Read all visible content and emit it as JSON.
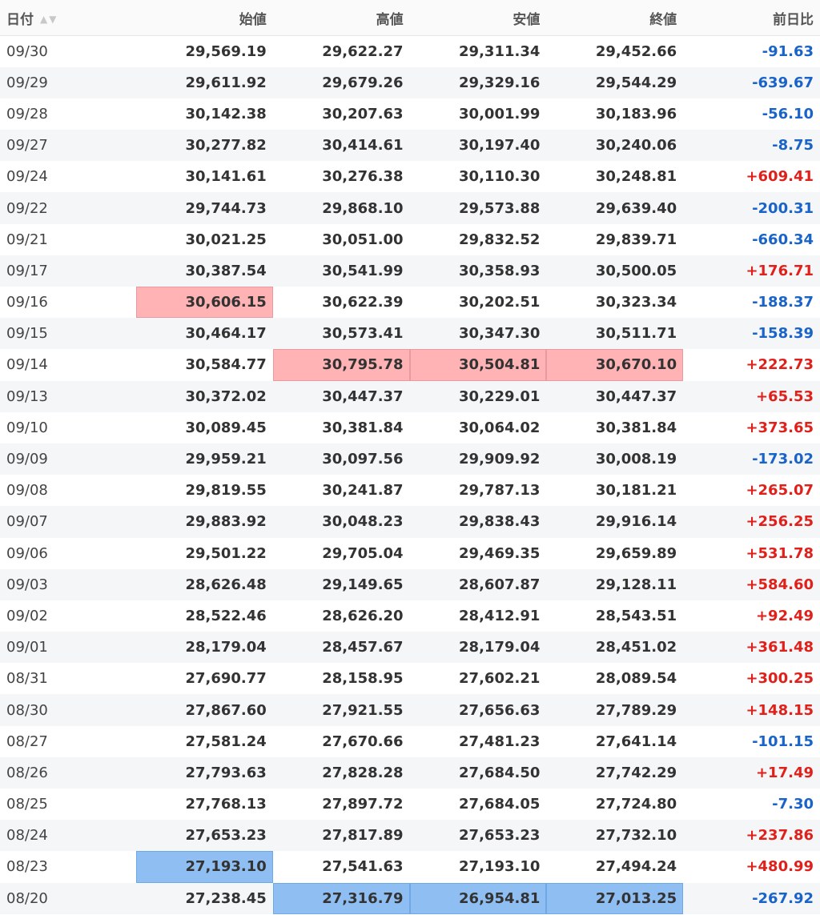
{
  "headers": {
    "date": "日付",
    "open": "始値",
    "high": "高値",
    "low": "安値",
    "close": "終値",
    "change": "前日比"
  },
  "colors": {
    "positive": "#e0201a",
    "negative": "#1a63c8",
    "high_highlight": "#ffb3b5",
    "low_highlight": "#8fbff2"
  },
  "rows": [
    {
      "date": "09/30",
      "open": "29,569.19",
      "high": "29,622.27",
      "low": "29,311.34",
      "close": "29,452.66",
      "change": "-91.63"
    },
    {
      "date": "09/29",
      "open": "29,611.92",
      "high": "29,679.26",
      "low": "29,329.16",
      "close": "29,544.29",
      "change": "-639.67"
    },
    {
      "date": "09/28",
      "open": "30,142.38",
      "high": "30,207.63",
      "low": "30,001.99",
      "close": "30,183.96",
      "change": "-56.10"
    },
    {
      "date": "09/27",
      "open": "30,277.82",
      "high": "30,414.61",
      "low": "30,197.40",
      "close": "30,240.06",
      "change": "-8.75"
    },
    {
      "date": "09/24",
      "open": "30,141.61",
      "high": "30,276.38",
      "low": "30,110.30",
      "close": "30,248.81",
      "change": "+609.41"
    },
    {
      "date": "09/22",
      "open": "29,744.73",
      "high": "29,868.10",
      "low": "29,573.88",
      "close": "29,639.40",
      "change": "-200.31"
    },
    {
      "date": "09/21",
      "open": "30,021.25",
      "high": "30,051.00",
      "low": "29,832.52",
      "close": "29,839.71",
      "change": "-660.34"
    },
    {
      "date": "09/17",
      "open": "30,387.54",
      "high": "30,541.99",
      "low": "30,358.93",
      "close": "30,500.05",
      "change": "+176.71"
    },
    {
      "date": "09/16",
      "open": "30,606.15",
      "high": "30,622.39",
      "low": "30,202.51",
      "close": "30,323.34",
      "change": "-188.37",
      "hl": {
        "open": "red"
      }
    },
    {
      "date": "09/15",
      "open": "30,464.17",
      "high": "30,573.41",
      "low": "30,347.30",
      "close": "30,511.71",
      "change": "-158.39"
    },
    {
      "date": "09/14",
      "open": "30,584.77",
      "high": "30,795.78",
      "low": "30,504.81",
      "close": "30,670.10",
      "change": "+222.73",
      "hl": {
        "high": "red",
        "low": "red",
        "close": "red"
      }
    },
    {
      "date": "09/13",
      "open": "30,372.02",
      "high": "30,447.37",
      "low": "30,229.01",
      "close": "30,447.37",
      "change": "+65.53"
    },
    {
      "date": "09/10",
      "open": "30,089.45",
      "high": "30,381.84",
      "low": "30,064.02",
      "close": "30,381.84",
      "change": "+373.65"
    },
    {
      "date": "09/09",
      "open": "29,959.21",
      "high": "30,097.56",
      "low": "29,909.92",
      "close": "30,008.19",
      "change": "-173.02"
    },
    {
      "date": "09/08",
      "open": "29,819.55",
      "high": "30,241.87",
      "low": "29,787.13",
      "close": "30,181.21",
      "change": "+265.07"
    },
    {
      "date": "09/07",
      "open": "29,883.92",
      "high": "30,048.23",
      "low": "29,838.43",
      "close": "29,916.14",
      "change": "+256.25"
    },
    {
      "date": "09/06",
      "open": "29,501.22",
      "high": "29,705.04",
      "low": "29,469.35",
      "close": "29,659.89",
      "change": "+531.78"
    },
    {
      "date": "09/03",
      "open": "28,626.48",
      "high": "29,149.65",
      "low": "28,607.87",
      "close": "29,128.11",
      "change": "+584.60"
    },
    {
      "date": "09/02",
      "open": "28,522.46",
      "high": "28,626.20",
      "low": "28,412.91",
      "close": "28,543.51",
      "change": "+92.49"
    },
    {
      "date": "09/01",
      "open": "28,179.04",
      "high": "28,457.67",
      "low": "28,179.04",
      "close": "28,451.02",
      "change": "+361.48"
    },
    {
      "date": "08/31",
      "open": "27,690.77",
      "high": "28,158.95",
      "low": "27,602.21",
      "close": "28,089.54",
      "change": "+300.25"
    },
    {
      "date": "08/30",
      "open": "27,867.60",
      "high": "27,921.55",
      "low": "27,656.63",
      "close": "27,789.29",
      "change": "+148.15"
    },
    {
      "date": "08/27",
      "open": "27,581.24",
      "high": "27,670.66",
      "low": "27,481.23",
      "close": "27,641.14",
      "change": "-101.15"
    },
    {
      "date": "08/26",
      "open": "27,793.63",
      "high": "27,828.28",
      "low": "27,684.50",
      "close": "27,742.29",
      "change": "+17.49"
    },
    {
      "date": "08/25",
      "open": "27,768.13",
      "high": "27,897.72",
      "low": "27,684.05",
      "close": "27,724.80",
      "change": "-7.30"
    },
    {
      "date": "08/24",
      "open": "27,653.23",
      "high": "27,817.89",
      "low": "27,653.23",
      "close": "27,732.10",
      "change": "+237.86"
    },
    {
      "date": "08/23",
      "open": "27,193.10",
      "high": "27,541.63",
      "low": "27,193.10",
      "close": "27,494.24",
      "change": "+480.99",
      "hl": {
        "open": "blue"
      }
    },
    {
      "date": "08/20",
      "open": "27,238.45",
      "high": "27,316.79",
      "low": "26,954.81",
      "close": "27,013.25",
      "change": "-267.92",
      "hl": {
        "high": "blue",
        "low": "blue",
        "close": "blue"
      }
    }
  ]
}
